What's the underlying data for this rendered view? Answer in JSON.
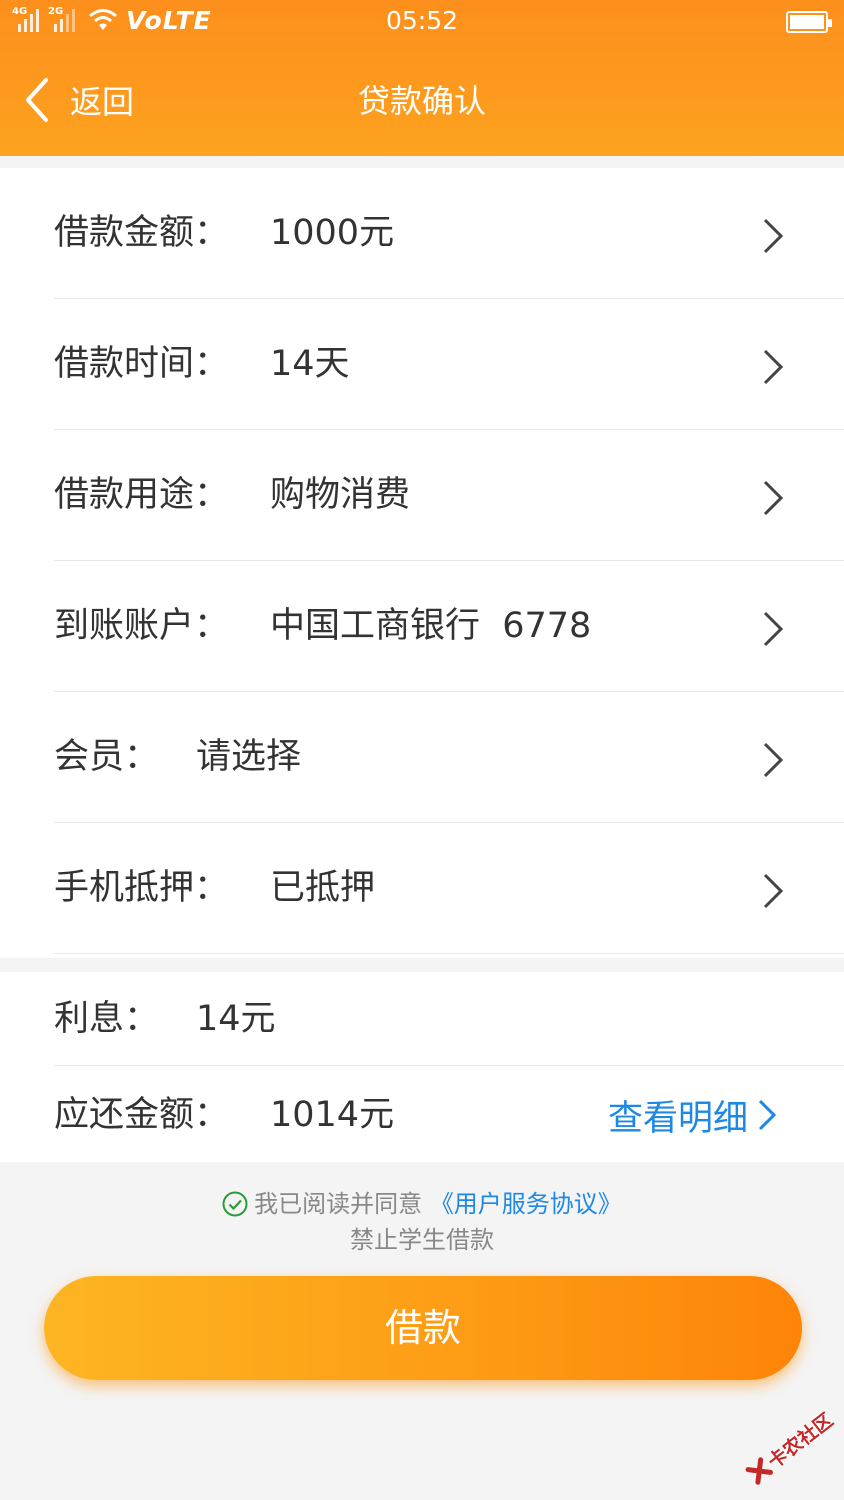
{
  "status_bar": {
    "network_1": "4G",
    "network_2": "2G",
    "volte": "VoLTE",
    "time": "05:52"
  },
  "nav": {
    "back_label": "返回",
    "title": "贷款确认"
  },
  "loan_rows": [
    {
      "label": "借款金额：",
      "value": "1000元"
    },
    {
      "label": "借款时间：",
      "value": "14天"
    },
    {
      "label": "借款用途：",
      "value": "购物消费"
    },
    {
      "label": "到账账户：",
      "value": "中国工商银行  6778"
    },
    {
      "label": "会员：",
      "value": "请选择"
    },
    {
      "label": "手机抵押：",
      "value": "已抵押"
    }
  ],
  "summary": {
    "interest_label": "利息：",
    "interest_value": "14元",
    "repay_label": "应还金额：",
    "repay_value": "1014元",
    "detail_link": "查看明细"
  },
  "agreement": {
    "prefix": "我已阅读并同意",
    "link": "《用户服务协议》",
    "notice": "禁止学生借款"
  },
  "submit_label": "借款",
  "watermark": "卡农社区",
  "colors": {
    "accent": "#fd9a14",
    "link": "#1e88e5",
    "check": "#2e9b3b"
  },
  "icons": {
    "back": "chevron-left-icon",
    "row_arrow": "chevron-right-icon",
    "agree": "check-circle-icon"
  }
}
